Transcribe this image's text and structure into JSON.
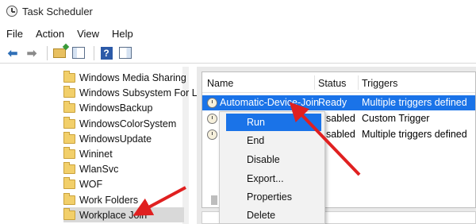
{
  "window": {
    "title": "Task Scheduler"
  },
  "menubar": {
    "items": [
      "File",
      "Action",
      "View",
      "Help"
    ]
  },
  "tree": {
    "items": [
      {
        "label": "Windows Media Sharing",
        "selected": false
      },
      {
        "label": "Windows Subsystem For Li",
        "selected": false
      },
      {
        "label": "WindowsBackup",
        "selected": false
      },
      {
        "label": "WindowsColorSystem",
        "selected": false
      },
      {
        "label": "WindowsUpdate",
        "selected": false
      },
      {
        "label": "Wininet",
        "selected": false
      },
      {
        "label": "WlanSvc",
        "selected": false
      },
      {
        "label": "WOF",
        "selected": false
      },
      {
        "label": "Work Folders",
        "selected": false
      },
      {
        "label": "Workplace Join",
        "selected": true
      }
    ]
  },
  "task_list": {
    "columns": [
      "Name",
      "Status",
      "Triggers"
    ],
    "rows": [
      {
        "name": "Automatic-Device-Join",
        "status": "Ready",
        "triggers": "Multiple triggers defined",
        "selected": true
      },
      {
        "name": "",
        "status": "sabled",
        "triggers": "Custom Trigger",
        "selected": false
      },
      {
        "name": "",
        "status": "sabled",
        "triggers": "Multiple triggers defined",
        "selected": false
      }
    ]
  },
  "context_menu": {
    "items": [
      {
        "label": "Run",
        "highlighted": true
      },
      {
        "label": "End",
        "highlighted": false
      },
      {
        "label": "Disable",
        "highlighted": false
      },
      {
        "label": "Export...",
        "highlighted": false
      },
      {
        "label": "Properties",
        "highlighted": false
      },
      {
        "label": "Delete",
        "highlighted": false
      }
    ]
  },
  "colors": {
    "selection": "#1a73e8",
    "annotation_arrow": "#e02020",
    "folder": "#f2cf6a"
  },
  "icons": [
    "task-scheduler-icon",
    "back-arrow-icon",
    "forward-arrow-icon",
    "up-folder-icon",
    "show-hide-console-tree-icon",
    "help-icon",
    "action-pane-icon",
    "folder-icon",
    "task-icon"
  ]
}
